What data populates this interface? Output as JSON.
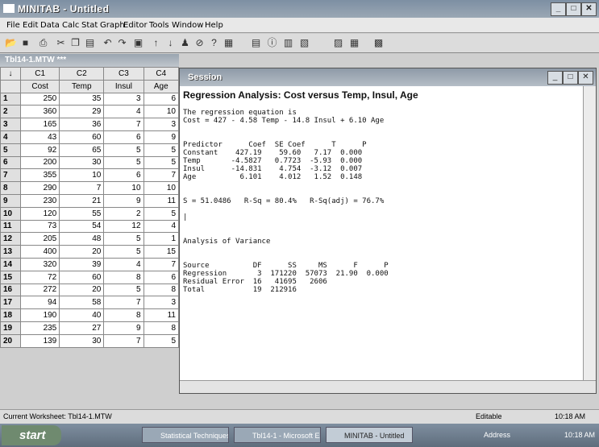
{
  "window": {
    "title": "MINITAB - Untitled"
  },
  "menu": [
    "File",
    "Edit",
    "Data",
    "Calc",
    "Stat",
    "Graph",
    "Editor",
    "Tools",
    "Window",
    "Help"
  ],
  "worksheet": {
    "title": "Tbl14-1.MTW ***",
    "columns": [
      "C1",
      "C2",
      "C3",
      "C4"
    ],
    "names": [
      "Cost",
      "Temp",
      "Insul",
      "Age"
    ],
    "rows": [
      [
        "250",
        "35",
        "3",
        "6"
      ],
      [
        "360",
        "29",
        "4",
        "10"
      ],
      [
        "165",
        "36",
        "7",
        "3"
      ],
      [
        "43",
        "60",
        "6",
        "9"
      ],
      [
        "92",
        "65",
        "5",
        "5"
      ],
      [
        "200",
        "30",
        "5",
        "5"
      ],
      [
        "355",
        "10",
        "6",
        "7"
      ],
      [
        "290",
        "7",
        "10",
        "10"
      ],
      [
        "230",
        "21",
        "9",
        "11"
      ],
      [
        "120",
        "55",
        "2",
        "5"
      ],
      [
        "73",
        "54",
        "12",
        "4"
      ],
      [
        "205",
        "48",
        "5",
        "1"
      ],
      [
        "400",
        "20",
        "5",
        "15"
      ],
      [
        "320",
        "39",
        "4",
        "7"
      ],
      [
        "72",
        "60",
        "8",
        "6"
      ],
      [
        "272",
        "20",
        "5",
        "8"
      ],
      [
        "94",
        "58",
        "7",
        "3"
      ],
      [
        "190",
        "40",
        "8",
        "11"
      ],
      [
        "235",
        "27",
        "9",
        "8"
      ],
      [
        "139",
        "30",
        "7",
        "5"
      ]
    ]
  },
  "session": {
    "title": "Session",
    "heading": "Regression Analysis: Cost versus Temp, Insul, Age",
    "eq_label": "The regression equation is",
    "equation": "Cost = 427 - 4.58 Temp - 14.8 Insul + 6.10 Age",
    "coef_header": "Predictor      Coef  SE Coef      T      P",
    "coef_rows": [
      "Constant    427.19    59.60   7.17  0.000",
      "Temp       -4.5827   0.7723  -5.93  0.000",
      "Insul      -14.831    4.754  -3.12  0.007",
      "Age          6.101    4.012   1.52  0.148"
    ],
    "fit": "S = 51.0486   R-Sq = 80.4%   R-Sq(adj) = 76.7%",
    "anova_title": "Analysis of Variance",
    "anova_header": "Source          DF      SS     MS      F      P",
    "anova_rows": [
      "Regression       3  171220  57073  21.90  0.000",
      "Residual Error  16   41695   2606",
      "Total           19  212916"
    ]
  },
  "status": {
    "worksheet": "Current Worksheet: Tbl14-1.MTW",
    "mode": "Editable",
    "time": "10:18 AM"
  },
  "taskbar": {
    "start": "start",
    "tasks": [
      "Statistical Techniques...",
      "Tbl14-1 - Microsoft Ex...",
      "MINITAB - Untitled"
    ],
    "address": "Address",
    "clock": "10:18 AM"
  }
}
